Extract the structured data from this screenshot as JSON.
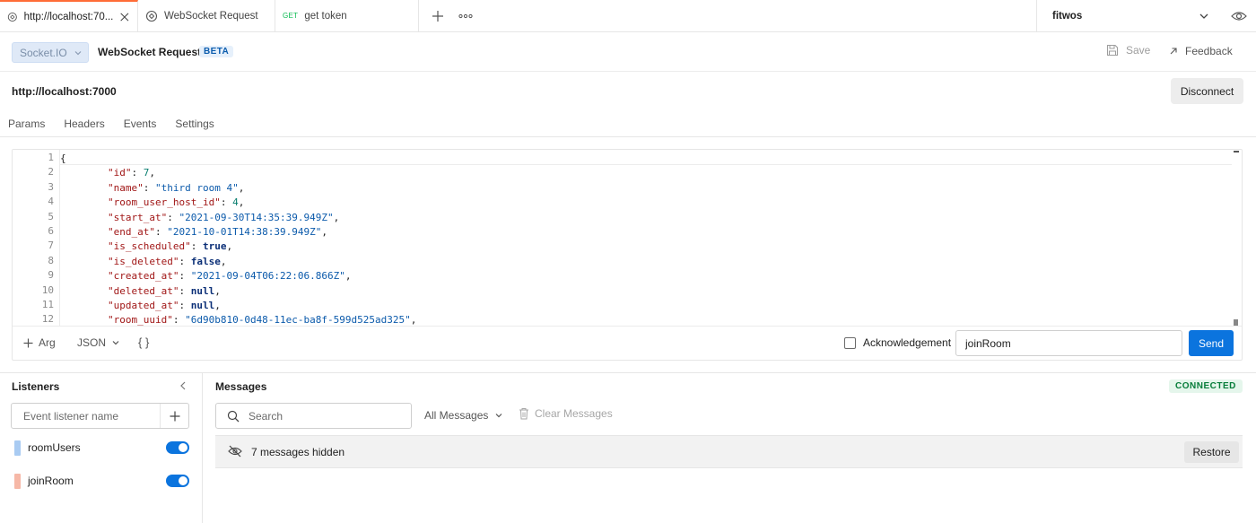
{
  "tabs": [
    {
      "label": "http://localhost:70...",
      "active": true
    },
    {
      "label": "WebSocket Request"
    },
    {
      "method": "GET",
      "label": "get token"
    }
  ],
  "environment": {
    "name": "fitwos"
  },
  "request": {
    "protocol": "Socket.IO",
    "name": "WebSocket Request",
    "badge": "BETA",
    "save_label": "Save",
    "feedback_label": "Feedback",
    "url": "http://localhost:7000",
    "disconnect_label": "Disconnect"
  },
  "subtabs": [
    "Params",
    "Headers",
    "Events",
    "Settings"
  ],
  "editor": {
    "line_numbers": [
      "1",
      "2",
      "3",
      "4",
      "5",
      "6",
      "7",
      "8",
      "9",
      "10",
      "11",
      "12"
    ],
    "lines": [
      [
        {
          "t": "p",
          "v": "{"
        }
      ],
      [
        {
          "t": "p",
          "v": "        "
        },
        {
          "t": "k",
          "v": "\"id\""
        },
        {
          "t": "p",
          "v": ": "
        },
        {
          "t": "n",
          "v": "7"
        },
        {
          "t": "p",
          "v": ","
        }
      ],
      [
        {
          "t": "p",
          "v": "        "
        },
        {
          "t": "k",
          "v": "\"name\""
        },
        {
          "t": "p",
          "v": ": "
        },
        {
          "t": "s",
          "v": "\"third room 4\""
        },
        {
          "t": "p",
          "v": ","
        }
      ],
      [
        {
          "t": "p",
          "v": "        "
        },
        {
          "t": "k",
          "v": "\"room_user_host_id\""
        },
        {
          "t": "p",
          "v": ": "
        },
        {
          "t": "n",
          "v": "4"
        },
        {
          "t": "p",
          "v": ","
        }
      ],
      [
        {
          "t": "p",
          "v": "        "
        },
        {
          "t": "k",
          "v": "\"start_at\""
        },
        {
          "t": "p",
          "v": ": "
        },
        {
          "t": "s",
          "v": "\"2021-09-30T14:35:39.949Z\""
        },
        {
          "t": "p",
          "v": ","
        }
      ],
      [
        {
          "t": "p",
          "v": "        "
        },
        {
          "t": "k",
          "v": "\"end_at\""
        },
        {
          "t": "p",
          "v": ": "
        },
        {
          "t": "s",
          "v": "\"2021-10-01T14:38:39.949Z\""
        },
        {
          "t": "p",
          "v": ","
        }
      ],
      [
        {
          "t": "p",
          "v": "        "
        },
        {
          "t": "k",
          "v": "\"is_scheduled\""
        },
        {
          "t": "p",
          "v": ": "
        },
        {
          "t": "b",
          "v": "true"
        },
        {
          "t": "p",
          "v": ","
        }
      ],
      [
        {
          "t": "p",
          "v": "        "
        },
        {
          "t": "k",
          "v": "\"is_deleted\""
        },
        {
          "t": "p",
          "v": ": "
        },
        {
          "t": "b",
          "v": "false"
        },
        {
          "t": "p",
          "v": ","
        }
      ],
      [
        {
          "t": "p",
          "v": "        "
        },
        {
          "t": "k",
          "v": "\"created_at\""
        },
        {
          "t": "p",
          "v": ": "
        },
        {
          "t": "s",
          "v": "\"2021-09-04T06:22:06.866Z\""
        },
        {
          "t": "p",
          "v": ","
        }
      ],
      [
        {
          "t": "p",
          "v": "        "
        },
        {
          "t": "k",
          "v": "\"deleted_at\""
        },
        {
          "t": "p",
          "v": ": "
        },
        {
          "t": "b",
          "v": "null"
        },
        {
          "t": "p",
          "v": ","
        }
      ],
      [
        {
          "t": "p",
          "v": "        "
        },
        {
          "t": "k",
          "v": "\"updated_at\""
        },
        {
          "t": "p",
          "v": ": "
        },
        {
          "t": "b",
          "v": "null"
        },
        {
          "t": "p",
          "v": ","
        }
      ],
      [
        {
          "t": "p",
          "v": "        "
        },
        {
          "t": "k",
          "v": "\"room_uuid\""
        },
        {
          "t": "p",
          "v": ": "
        },
        {
          "t": "s",
          "v": "\"6d90b810-0d48-11ec-ba8f-599d525ad325\""
        },
        {
          "t": "p",
          "v": ","
        }
      ]
    ]
  },
  "editor_footer": {
    "arg_label": "Arg",
    "format_label": "JSON",
    "braces_label": "{ }",
    "ack_label": "Acknowledgement",
    "event_name_value": "joinRoom",
    "send_label": "Send"
  },
  "listeners": {
    "title": "Listeners",
    "input_placeholder": "Event listener name",
    "items": [
      {
        "name": "roomUsers",
        "color": "#a9cbf2",
        "enabled": true
      },
      {
        "name": "joinRoom",
        "color": "#f6b8a7",
        "enabled": true
      }
    ]
  },
  "messages": {
    "title": "Messages",
    "status": "CONNECTED",
    "search_placeholder": "Search",
    "filter_label": "All Messages",
    "clear_label": "Clear Messages",
    "hidden_label": "7 messages hidden",
    "restore_label": "Restore"
  },
  "colors": {
    "accent": "#0b74de",
    "active_tab": "#ff6c37",
    "connected": "#077d3a"
  }
}
